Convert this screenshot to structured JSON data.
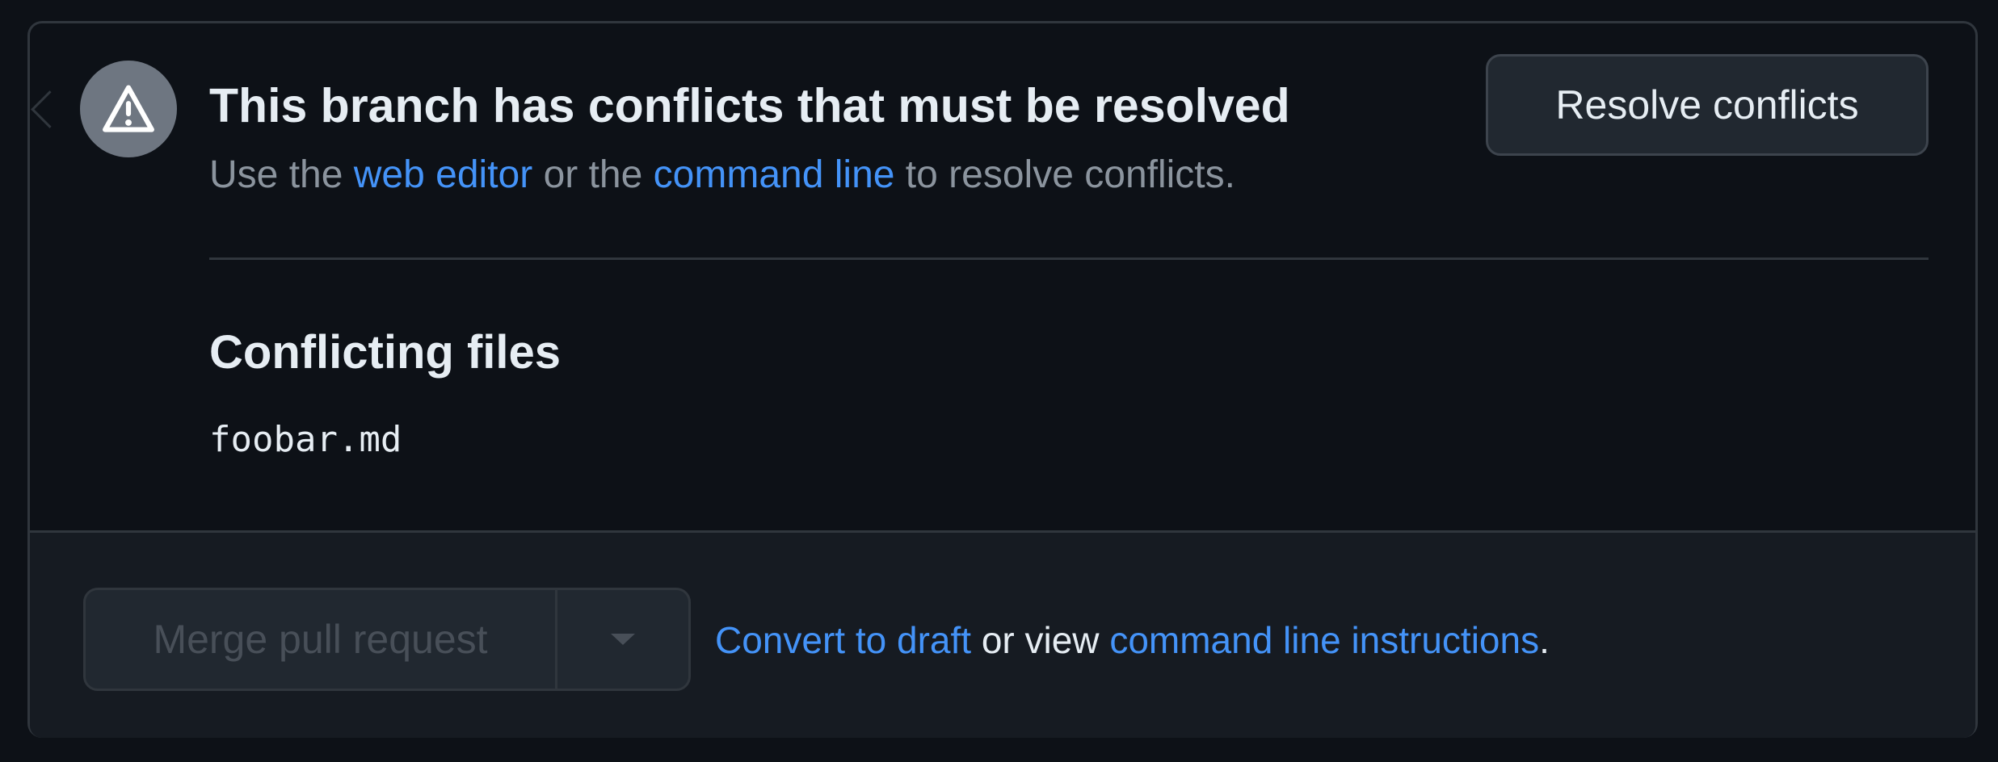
{
  "merge_box": {
    "title": "This branch has conflicts that must be resolved",
    "description": {
      "prefix": "Use the ",
      "web_editor_link": "web editor",
      "middle": " or the ",
      "command_line_link": "command line",
      "suffix": " to resolve conflicts."
    },
    "resolve_button_label": "Resolve conflicts",
    "conflicting_files": {
      "heading": "Conflicting files",
      "files": [
        "foobar.md"
      ]
    },
    "alert_icon": "alert-triangle-icon"
  },
  "footer": {
    "merge_button_label": "Merge pull request",
    "merge_button_disabled": true,
    "dropdown_icon": "triangle-down-icon",
    "convert_to_draft_link": "Convert to draft",
    "or_view_text": " or view ",
    "command_line_instructions_link": "command line instructions",
    "trailing_period": "."
  },
  "colors": {
    "background": "#0d1117",
    "footer_background": "#161b22",
    "border": "#30363d",
    "link": "#4493f8",
    "text_primary": "#e6edf3",
    "text_muted": "#8b949e",
    "alert_circle": "#6e7681",
    "disabled_text": "#484f58"
  }
}
